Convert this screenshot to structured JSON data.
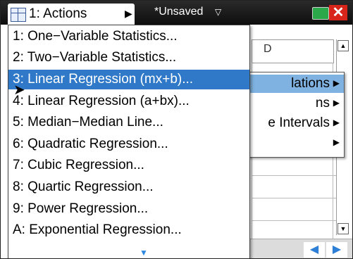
{
  "titlebar": {
    "app_label": "1: Actions",
    "app_menu_arrow": "▶",
    "document_title": "*Unsaved",
    "document_arrow": "▽",
    "close_symbol": "✕"
  },
  "spreadsheet": {
    "column_header": "D"
  },
  "submenu": {
    "items": [
      {
        "label": "lations",
        "arrow": "▶"
      },
      {
        "label": "ns",
        "arrow": "▶"
      },
      {
        "label": "e Intervals",
        "arrow": "▶"
      },
      {
        "label": "",
        "arrow": "▶"
      }
    ]
  },
  "menu": {
    "items": [
      {
        "label": "1: One−Variable Statistics..."
      },
      {
        "label": "2: Two−Variable Statistics..."
      },
      {
        "label": "3: Linear Regression (mx+b)..."
      },
      {
        "label": "4: Linear Regression (a+bx)..."
      },
      {
        "label": "5: Median−Median Line..."
      },
      {
        "label": "6: Quadratic Regression..."
      },
      {
        "label": "7: Cubic Regression..."
      },
      {
        "label": "8: Quartic Regression..."
      },
      {
        "label": "9: Power Regression..."
      },
      {
        "label": "A: Exponential Regression..."
      }
    ],
    "selected_index": 2,
    "more_indicator": "▼"
  },
  "navigation": {
    "prev_symbol": "◀",
    "next_symbol": "▶"
  },
  "colors": {
    "selection": "#2f79c8",
    "submenu_selection": "#7fb2e0",
    "title_bar": "#111111",
    "close_button": "#d8251c",
    "battery": "#2aa84a"
  }
}
